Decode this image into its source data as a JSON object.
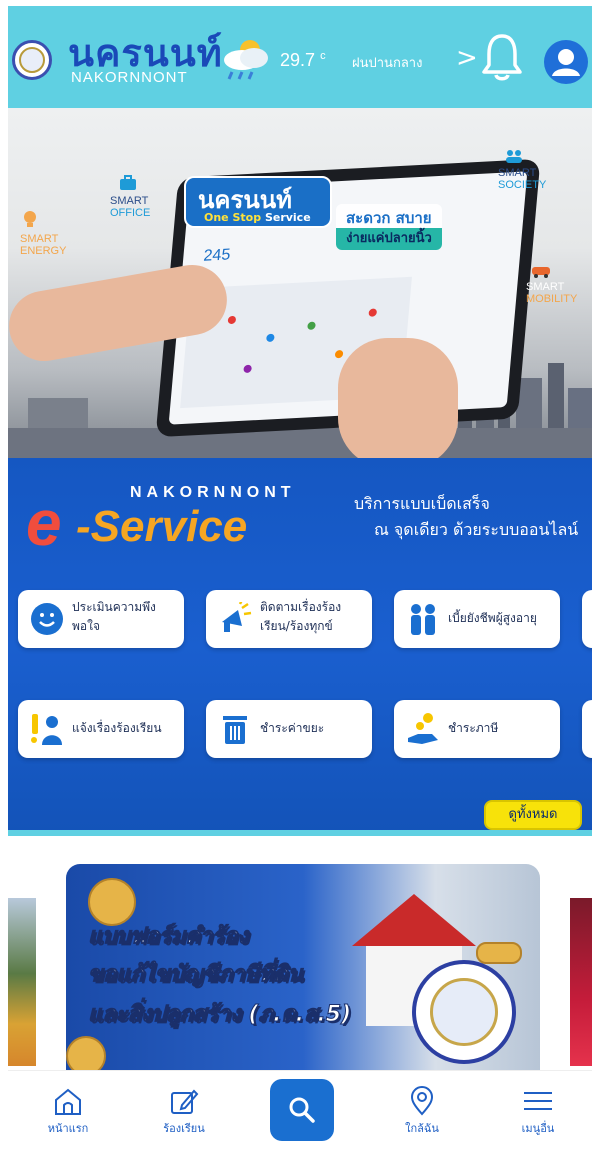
{
  "header": {
    "brand_th": "นครนนท์",
    "brand_en": "NAKORNNONT",
    "temperature": "29.7",
    "temperature_unit": "c",
    "weather": "ฝนปานกลาง",
    "chevron": ">",
    "icons": [
      "city-seal-icon",
      "weather-rain-icon",
      "bell-icon",
      "user-avatar-icon"
    ],
    "colors": {
      "background": "#5fd0e2",
      "brand": "#1a49b8"
    }
  },
  "hero": {
    "smart_labels": [
      {
        "line1": "SMART",
        "line2": "ENERGY"
      },
      {
        "line1": "SMART",
        "line2": "OFFICE"
      },
      {
        "line1": "SMART",
        "line2": "SOCIETY"
      },
      {
        "line1": "SMART",
        "line2": "MOBILITY"
      }
    ],
    "oss_title": "นครนนท์",
    "oss_sub_a": "One Stop",
    "oss_sub_b": "Service",
    "easy_line1": "สะดวก สบาย",
    "easy_line2": "ง่ายแค่ปลายนิ้ว",
    "tablet_stat": "245"
  },
  "eservice": {
    "nakornnont": "NAKORNNONT",
    "logo_e": "e",
    "logo_service": "-Service",
    "tagline1": "บริการแบบเบ็ดเสร็จ",
    "tagline2": "ณ จุดเดียว ด้วยระบบออนไลน์",
    "services": [
      {
        "label": "ประเมินความพึงพอใจ",
        "icon": "smiley-icon"
      },
      {
        "label": "ติดตามเรื่องร้องเรียน/ร้องทุกข์",
        "icon": "megaphone-icon"
      },
      {
        "label": "เบี้ยยังชีพผู้สูงอายุ",
        "icon": "elderly-couple-icon"
      },
      {
        "label": "แจ้งเรื่องร้องเรียน",
        "icon": "complaint-person-icon"
      },
      {
        "label": "ชำระค่าขยะ",
        "icon": "trash-bin-icon"
      },
      {
        "label": "ชำระภาษี",
        "icon": "coin-hand-icon"
      }
    ],
    "see_all": "ดูทั้งหมด",
    "colors": {
      "background": "#1557c2",
      "see_all": "#f7e20a"
    }
  },
  "banner": {
    "line1": "แบบฟอร์มคำร้อง",
    "line2": "ขอแก้ไขบัญชีภาษีที่ดิน",
    "line3": "และสิ่งปลูกสร้าง (ภ.ด.ส.5)"
  },
  "bottom_nav": {
    "items": [
      {
        "label": "หน้าแรก",
        "icon": "home-icon"
      },
      {
        "label": "ร้องเรียน",
        "icon": "edit-icon"
      },
      {
        "label": "",
        "icon": "search-icon"
      },
      {
        "label": "ใกล้ฉัน",
        "icon": "location-pin-icon"
      },
      {
        "label": "เมนูอื่น",
        "icon": "hamburger-menu-icon"
      }
    ],
    "accent": "#1a6fd0"
  }
}
